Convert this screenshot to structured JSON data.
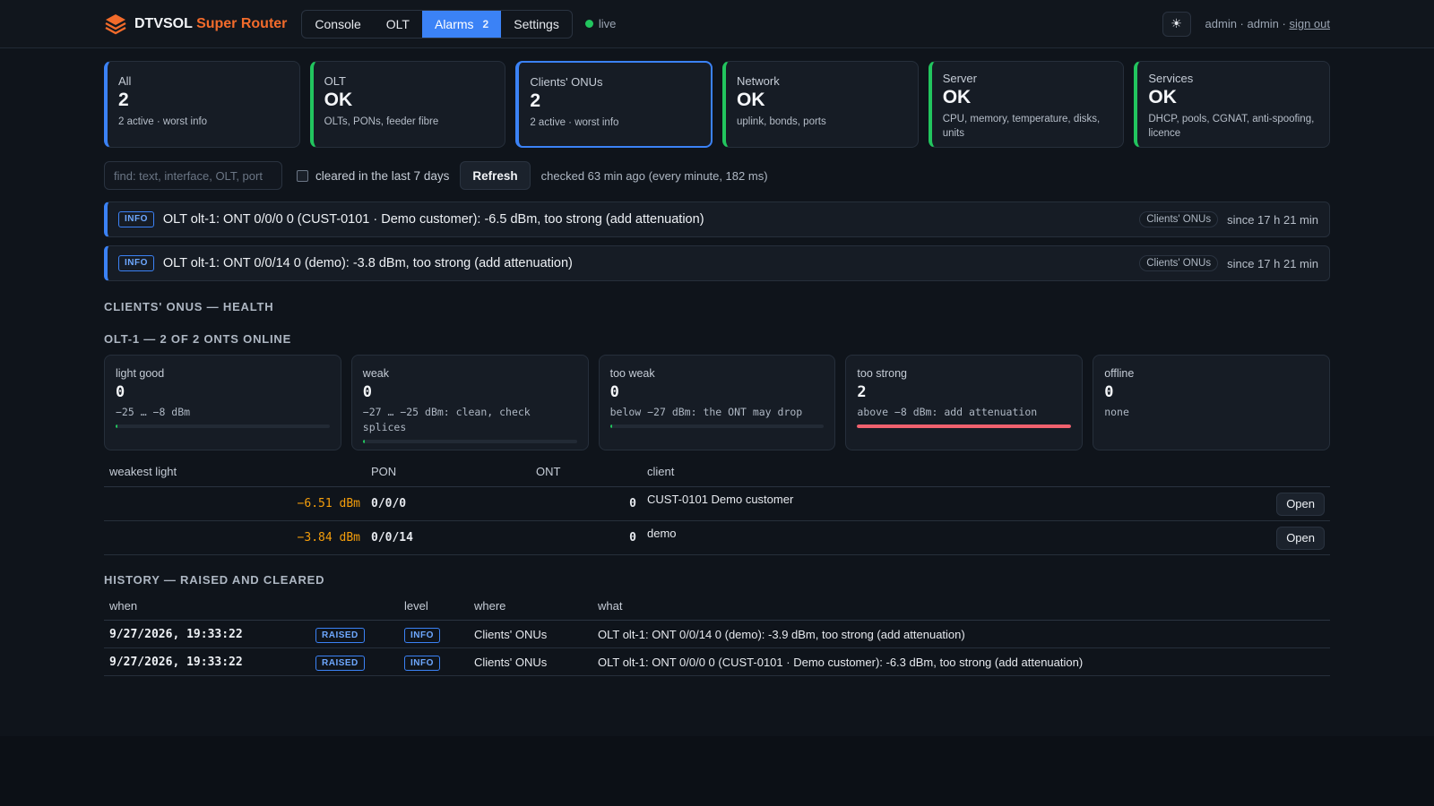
{
  "app": {
    "brand_main": "DTVSOL",
    "brand_accent": "Super Router",
    "nav": [
      {
        "label": "Console"
      },
      {
        "label": "OLT"
      },
      {
        "label": "Alarms",
        "badge": "2"
      },
      {
        "label": "Settings"
      }
    ],
    "live_label": "live",
    "theme_icon": "☀",
    "user_text": "admin · admin · ",
    "sign_out": "sign out"
  },
  "summary": [
    {
      "title": "All",
      "value": "2",
      "sub": "2 active · worst info"
    },
    {
      "title": "OLT",
      "value": "OK",
      "sub": "OLTs, PONs, feeder fibre"
    },
    {
      "title": "Clients' ONUs",
      "value": "2",
      "sub": "2 active · worst info"
    },
    {
      "title": "Network",
      "value": "OK",
      "sub": "uplink, bonds, ports"
    },
    {
      "title": "Server",
      "value": "OK",
      "sub": "CPU, memory, temperature, disks, units"
    },
    {
      "title": "Services",
      "value": "OK",
      "sub": "DHCP, pools, CGNAT, anti-spoofing, licence"
    }
  ],
  "filters": {
    "find_placeholder": "find: text, interface, OLT, port",
    "cleared_label": "cleared in the last 7 days",
    "refresh_label": "Refresh",
    "checked_text": "checked 63 min ago (every minute, 182 ms)"
  },
  "alarms": [
    {
      "level": "INFO",
      "text": "OLT olt-1: ONT 0/0/0 0 (CUST-0101 · Demo customer): -6.5 dBm, too strong (add attenuation)",
      "category": "Clients' ONUs",
      "since": "since 17 h 21 min"
    },
    {
      "level": "INFO",
      "text": "OLT olt-1: ONT 0/0/14 0 (demo): -3.8 dBm, too strong (add attenuation)",
      "category": "Clients' ONUs",
      "since": "since 17 h 21 min"
    }
  ],
  "health": {
    "title": "Clients' ONUs — health",
    "olt_title": "olt-1 — 2 of 2 ONTs online",
    "buckets": [
      {
        "label": "light good",
        "count": "0",
        "desc": "−25 … −8 dBm",
        "fill": 0.01,
        "color": "#22c55e"
      },
      {
        "label": "weak",
        "count": "0",
        "desc": "−27 … −25 dBm: clean, check splices",
        "fill": 0.01,
        "color": "#22c55e"
      },
      {
        "label": "too weak",
        "count": "0",
        "desc": "below −27 dBm: the ONT may drop",
        "fill": 0.01,
        "color": "#22c55e"
      },
      {
        "label": "too strong",
        "count": "2",
        "desc": "above −8 dBm: add attenuation",
        "fill": 1.0,
        "color": "#f0616e"
      },
      {
        "label": "offline",
        "count": "0",
        "desc": "none",
        "fill": null,
        "color": ""
      }
    ],
    "table": {
      "headers": [
        "weakest light",
        "PON",
        "ONT",
        "client"
      ],
      "rows": [
        {
          "light": "−6.51 dBm",
          "pon": "0/0/0",
          "ont": "0",
          "client": "CUST-0101 Demo customer",
          "action": "Open"
        },
        {
          "light": "−3.84 dBm",
          "pon": "0/0/14",
          "ont": "0",
          "client": "demo",
          "action": "Open"
        }
      ]
    }
  },
  "history": {
    "title": "History — raised and cleared",
    "headers": [
      "when",
      "",
      "level",
      "where",
      "what"
    ],
    "rows": [
      {
        "when": "9/27/2026, 19:33:22",
        "state": "RAISED",
        "level": "INFO",
        "where": "Clients' ONUs",
        "what": "OLT olt-1: ONT 0/0/14 0 (demo): -3.9 dBm, too strong (add attenuation)"
      },
      {
        "when": "9/27/2026, 19:33:22",
        "state": "RAISED",
        "level": "INFO",
        "where": "Clients' ONUs",
        "what": "OLT olt-1: ONT 0/0/0 0 (CUST-0101 · Demo customer): -6.3 dBm, too strong (add attenuation)"
      }
    ]
  }
}
